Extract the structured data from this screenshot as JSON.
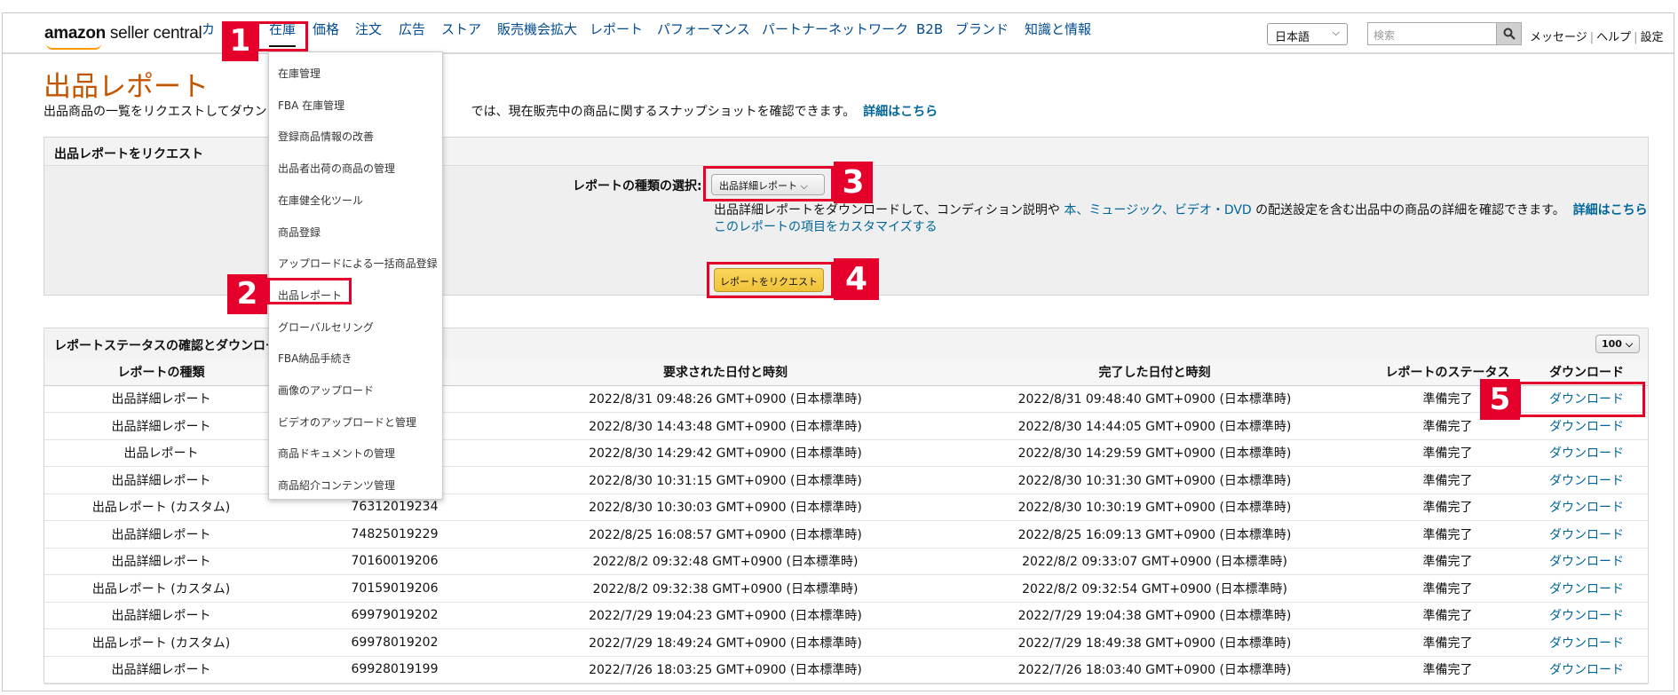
{
  "nav": {
    "logo_bold": "amazon",
    "logo_text": " seller central",
    "items": [
      "カ",
      "在庫",
      "価格",
      "注文",
      "広告",
      "ストア",
      "販売機会拡大",
      "レポート",
      "パフォーマンス",
      "パートナーネットワーク",
      "B2B",
      "ブランド",
      "知識と情報"
    ],
    "language": "日本語",
    "search_placeholder": "検索",
    "links": [
      "メッセージ",
      "ヘルプ",
      "設定"
    ]
  },
  "inventory_menu": {
    "items": [
      "在庫管理",
      "FBA 在庫管理",
      "登録商品情報の改善",
      "出品者出荷の商品の管理",
      "在庫健全化ツール",
      "商品登録",
      "アップロードによる一括商品登録",
      "出品レポート",
      "グローバルセリング",
      "FBA納品手続き",
      "画像のアップロード",
      "ビデオのアップロードと管理",
      "商品ドキュメントの管理",
      "商品紹介コンテンツ管理"
    ]
  },
  "page": {
    "title": "出品レポート",
    "desc_left": "出品商品の一覧をリクエストしてダウン",
    "desc_right": "では、現在販売中の商品に関するスナップショットを確認できます。",
    "desc_link": "詳細はこちら"
  },
  "request": {
    "heading": "出品レポートをリクエスト",
    "type_label": "レポートの種類の選択:",
    "type_value": "出品詳細レポート",
    "desc_a": "出品詳細レポートをダウンロードして、コンディション説明や ",
    "desc_b": "本、ミュージック、ビデオ・DVD",
    "desc_c": " の配送設定を含む出品中の商品の詳細を確認できます。",
    "desc_link": "詳細はこちら",
    "customize_link": "このレポートの項目をカスタマイズする",
    "button": "レポートをリクエスト"
  },
  "status": {
    "heading": "レポートステータスの確認とダウンロー",
    "page_size": "100",
    "columns": [
      "レポートの種類",
      "",
      "要求された日付と時刻",
      "完了した日付と時刻",
      "レポートのステータス",
      "ダウンロード"
    ],
    "rows": [
      [
        "出品詳細レポート",
        "",
        "2022/8/31 09:48:26 GMT+0900 (日本標準時)",
        "2022/8/31 09:48:40 GMT+0900 (日本標準時)",
        "準備完了",
        "ダウンロード"
      ],
      [
        "出品詳細レポート",
        "",
        "2022/8/30 14:43:48 GMT+0900 (日本標準時)",
        "2022/8/30 14:44:05 GMT+0900 (日本標準時)",
        "準備完了",
        "ダウンロード"
      ],
      [
        "出品レポート",
        "",
        "2022/8/30 14:29:42 GMT+0900 (日本標準時)",
        "2022/8/30 14:29:59 GMT+0900 (日本標準時)",
        "準備完了",
        "ダウンロード"
      ],
      [
        "出品詳細レポート",
        "",
        "2022/8/30 10:31:15 GMT+0900 (日本標準時)",
        "2022/8/30 10:31:30 GMT+0900 (日本標準時)",
        "準備完了",
        "ダウンロード"
      ],
      [
        "出品レポート (カスタム)",
        "76312019234",
        "2022/8/30 10:30:03 GMT+0900 (日本標準時)",
        "2022/8/30 10:30:19 GMT+0900 (日本標準時)",
        "準備完了",
        "ダウンロード"
      ],
      [
        "出品詳細レポート",
        "74825019229",
        "2022/8/25 16:08:57 GMT+0900 (日本標準時)",
        "2022/8/25 16:09:13 GMT+0900 (日本標準時)",
        "準備完了",
        "ダウンロード"
      ],
      [
        "出品詳細レポート",
        "70160019206",
        "2022/8/2 09:32:48 GMT+0900 (日本標準時)",
        "2022/8/2 09:33:07 GMT+0900 (日本標準時)",
        "準備完了",
        "ダウンロード"
      ],
      [
        "出品レポート (カスタム)",
        "70159019206",
        "2022/8/2 09:32:38 GMT+0900 (日本標準時)",
        "2022/8/2 09:32:54 GMT+0900 (日本標準時)",
        "準備完了",
        "ダウンロード"
      ],
      [
        "出品詳細レポート",
        "69979019202",
        "2022/7/29 19:04:23 GMT+0900 (日本標準時)",
        "2022/7/29 19:04:38 GMT+0900 (日本標準時)",
        "準備完了",
        "ダウンロード"
      ],
      [
        "出品レポート (カスタム)",
        "69978019202",
        "2022/7/29 18:49:24 GMT+0900 (日本標準時)",
        "2022/7/29 18:49:38 GMT+0900 (日本標準時)",
        "準備完了",
        "ダウンロード"
      ],
      [
        "出品詳細レポート",
        "69928019199",
        "2022/7/26 18:03:25 GMT+0900 (日本標準時)",
        "2022/7/26 18:03:40 GMT+0900 (日本標準時)",
        "準備完了",
        "ダウンロード"
      ]
    ]
  },
  "markers": [
    "1",
    "2",
    "3",
    "4",
    "5"
  ],
  "colors": {
    "title": "#c45500",
    "link": "#00669a",
    "marker": "#e4002b",
    "button": "#f0c23a"
  }
}
